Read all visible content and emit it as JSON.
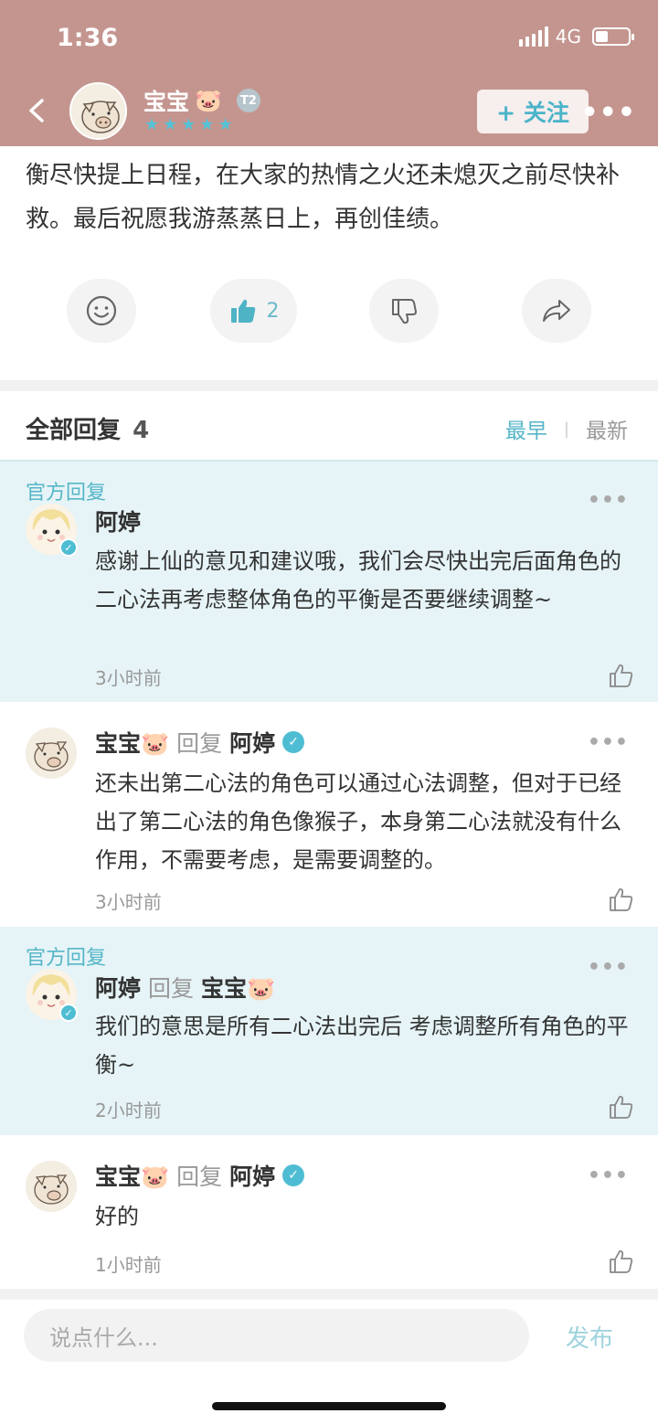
{
  "status_bar": {
    "time": "1:36",
    "network": "4G"
  },
  "header": {
    "author_name": "宝宝",
    "author_emoji": "🐷",
    "level_badge": "T2",
    "stars": 5,
    "follow_label": "+ 关注",
    "more_icon": "more-dots-icon"
  },
  "post": {
    "text": "衡尽快提上日程，在大家的热情之火还未熄灭之前尽快补救。最后祝愿我游蒸蒸日上，再创佳绩。"
  },
  "actions": {
    "emoji_icon": "smile-icon",
    "like_icon": "thumbs-up-icon",
    "like_count": "2",
    "dislike_icon": "thumbs-down-icon",
    "share_icon": "share-icon"
  },
  "replies_section": {
    "title": "全部回复",
    "count": "4",
    "sort_earliest": "最早",
    "sort_latest": "最新"
  },
  "comments": [
    {
      "official_label": "官方回复",
      "author": "阿婷",
      "reply_word": "",
      "reply_to": "",
      "body": "感谢上仙的意见和建议哦，我们会尽快出完后面角色的二心法再考虑整体角色的平衡是否要继续调整~",
      "time": "3小时前"
    },
    {
      "official_label": "",
      "author": "宝宝🐷",
      "reply_word": "回复",
      "reply_to": "阿婷",
      "body": "还未出第二心法的角色可以通过心法调整，但对于已经出了第二心法的角色像猴子，本身第二心法就没有什么作用，不需要考虑，是需要调整的。",
      "time": "3小时前"
    },
    {
      "official_label": "官方回复",
      "author": "阿婷",
      "reply_word": "回复",
      "reply_to": "宝宝🐷",
      "body": "我们的意思是所有二心法出完后 考虑调整所有角色的平衡~",
      "time": "2小时前"
    },
    {
      "official_label": "",
      "author": "宝宝🐷",
      "reply_word": "回复",
      "reply_to": "阿婷",
      "body": "好的",
      "time": "1小时前"
    }
  ],
  "composer": {
    "placeholder": "说点什么...",
    "publish_label": "发布"
  },
  "colors": {
    "header_bg": "#c4958f",
    "accent": "#56b6c8",
    "official_bg": "#e6f4f7"
  }
}
